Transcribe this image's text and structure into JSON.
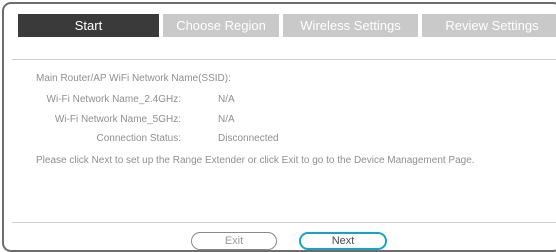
{
  "tabs": [
    {
      "label": "Start",
      "active": true
    },
    {
      "label": "Choose Region",
      "active": false
    },
    {
      "label": "Wireless Settings",
      "active": false
    },
    {
      "label": "Review Settings",
      "active": false
    }
  ],
  "info": {
    "main_ssid_label": "Main Router/AP WiFi Network Name(SSID):",
    "wifi_24_label": "Wi-Fi Network Name_2.4GHz:",
    "wifi_24_value": "N/A",
    "wifi_5_label": "Wi-Fi Network Name_5GHz:",
    "wifi_5_value": "N/A",
    "status_label": "Connection Status:",
    "status_value": "Disconnected",
    "instructions": "Please click Next to set up the Range Extender or click Exit to go to the Device Management Page."
  },
  "buttons": {
    "exit_label": "Exit",
    "next_label": "Next"
  },
  "colors": {
    "active_tab": "#3a3a3a",
    "inactive_tab": "#c9c9c9",
    "next_button_border": "#17a3c4"
  }
}
